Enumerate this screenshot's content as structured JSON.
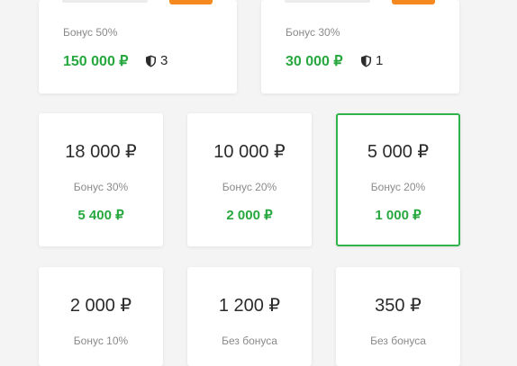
{
  "top_cards": [
    {
      "bonus": "Бонус 50%",
      "amount": "150 000 ₽",
      "shield_count": "3"
    },
    {
      "bonus": "Бонус 30%",
      "amount": "30 000 ₽",
      "shield_count": "1"
    }
  ],
  "packages": [
    {
      "price": "18 000 ₽",
      "bonus": "Бонус 30%",
      "amount": "5 400 ₽"
    },
    {
      "price": "10 000 ₽",
      "bonus": "Бонус 20%",
      "amount": "2 000 ₽"
    },
    {
      "price": "5 000 ₽",
      "bonus": "Бонус 20%",
      "amount": "1 000 ₽",
      "selected": true
    },
    {
      "price": "2 000 ₽",
      "bonus": "Бонус 10%"
    },
    {
      "price": "1 200 ₽",
      "bonus": "Без бонуса"
    },
    {
      "price": "350 ₽",
      "bonus": "Без бонуса"
    }
  ],
  "colors": {
    "accent_green": "#27a83f",
    "selected_border": "#2fb34a",
    "orange_tab": "#f5891f"
  },
  "icons": {
    "shield": "shield-icon"
  }
}
